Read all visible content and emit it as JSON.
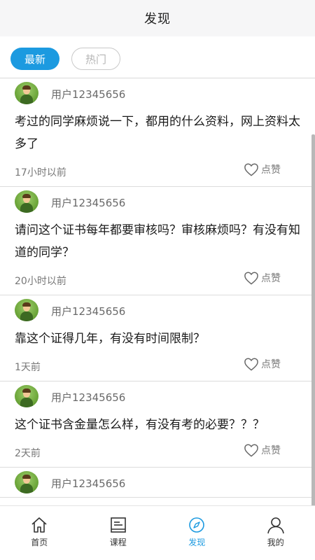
{
  "header": {
    "title": "发现"
  },
  "tabs": {
    "latest": "最新",
    "hot": "热门"
  },
  "posts": [
    {
      "user": "用户12345656",
      "text": "考过的同学麻烦说一下，都用的什么资料，网上资料太多了",
      "time": "17小时以前",
      "like": "点赞"
    },
    {
      "user": "用户12345656",
      "text": "请问这个证书每年都要审核吗？审核麻烦吗？有没有知道的同学？",
      "time": "20小时以前",
      "like": "点赞"
    },
    {
      "user": "用户12345656",
      "text": "靠这个证得几年，有没有时间限制？",
      "time": "1天前",
      "like": "点赞"
    },
    {
      "user": "用户12345656",
      "text": "这个证书含金量怎么样，有没有考的必要？？？",
      "time": "2天前",
      "like": "点赞"
    },
    {
      "user": "用户12345656",
      "text": "",
      "time": "",
      "like": ""
    }
  ],
  "nav": [
    {
      "label": "首页",
      "icon": "home-icon"
    },
    {
      "label": "课程",
      "icon": "course-icon"
    },
    {
      "label": "发现",
      "icon": "compass-icon"
    },
    {
      "label": "我的",
      "icon": "user-icon"
    }
  ],
  "colors": {
    "accent": "#1c9ae0",
    "header_bg": "#f6f6f7"
  }
}
